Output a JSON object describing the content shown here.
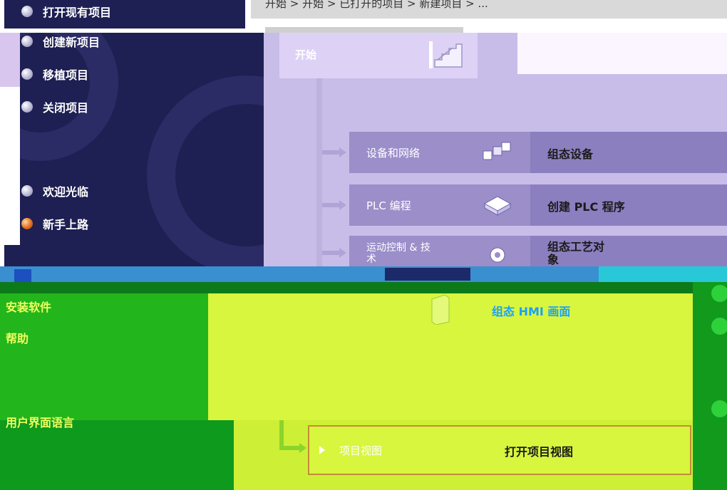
{
  "breadcrumb": "开始 > 开始 > 已打开的项目 > 新建项目 > ...",
  "sidebar": {
    "items": [
      {
        "label": "打开现有项目",
        "name": "sidebar-item-open-existing"
      },
      {
        "label": "创建新项目",
        "name": "sidebar-item-create-new"
      },
      {
        "label": "移植项目",
        "name": "sidebar-item-migrate"
      },
      {
        "label": "关闭项目",
        "name": "sidebar-item-close"
      },
      {
        "label": "欢迎光临",
        "name": "sidebar-item-welcome"
      },
      {
        "label": "新手上路",
        "name": "sidebar-item-first-steps"
      }
    ],
    "lower": [
      "安装软件",
      "帮助",
      "用户界面语言"
    ]
  },
  "start": {
    "title": "开始"
  },
  "rows": [
    {
      "label": "设备和网络",
      "action": "组态设备",
      "icon": "devices-icon"
    },
    {
      "label": "PLC 编程",
      "action": "创建 PLC 程序",
      "icon": "plc-program-icon"
    },
    {
      "label": "运动控制 & 技术",
      "action": "组态工艺对象",
      "icon": "gear-icon"
    }
  ],
  "hmi": {
    "action": "组态 HMI 画面"
  },
  "project_view": {
    "label": "项目视图",
    "action": "打开项目视图"
  },
  "colors": {
    "nav_bg": "#1e1f52",
    "lavender": "#c8bde8",
    "green": "#23b51c",
    "lime": "#d7f63d",
    "accent_orange": "#e07020"
  }
}
